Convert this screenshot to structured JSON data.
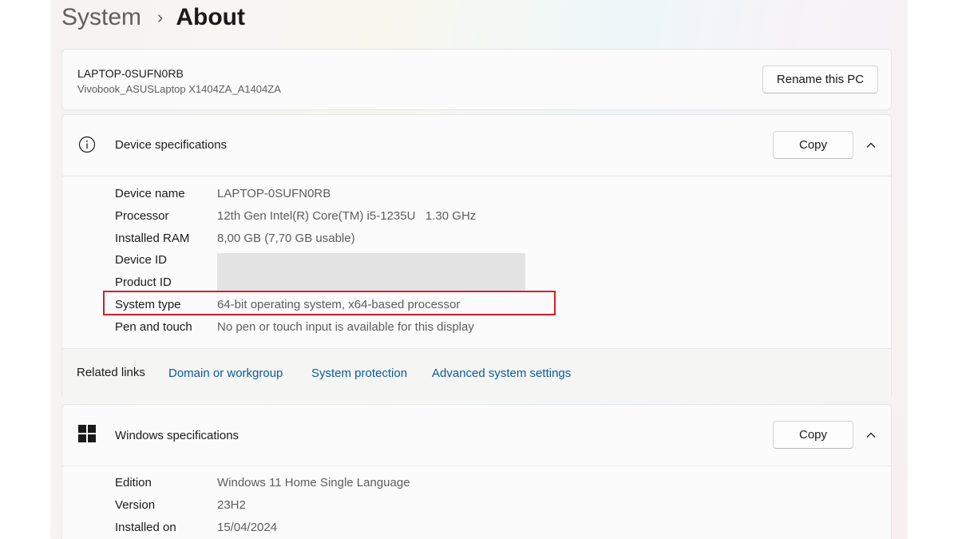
{
  "breadcrumb": {
    "parent": "System",
    "separator": "›",
    "current": "About"
  },
  "pc": {
    "name": "LAPTOP-0SUFN0RB",
    "model": "Vivobook_ASUSLaptop X1404ZA_A1404ZA",
    "rename_label": "Rename this PC"
  },
  "device_specs": {
    "title": "Device specifications",
    "copy_label": "Copy",
    "rows": [
      {
        "label": "Device name",
        "value": "LAPTOP-0SUFN0RB"
      },
      {
        "label": "Processor",
        "value": "12th Gen Intel(R) Core(TM) i5-1235U   1.30 GHz"
      },
      {
        "label": "Installed RAM",
        "value": "8,00 GB (7,70 GB usable)"
      },
      {
        "label": "Device ID",
        "value": ""
      },
      {
        "label": "Product ID",
        "value": ""
      },
      {
        "label": "System type",
        "value": "64-bit operating system, x64-based processor"
      },
      {
        "label": "Pen and touch",
        "value": "No pen or touch input is available for this display"
      }
    ],
    "related_label": "Related links",
    "related_links": [
      "Domain or workgroup",
      "System protection",
      "Advanced system settings"
    ]
  },
  "windows_specs": {
    "title": "Windows specifications",
    "copy_label": "Copy",
    "rows": [
      {
        "label": "Edition",
        "value": "Windows 11 Home Single Language"
      },
      {
        "label": "Version",
        "value": "23H2"
      },
      {
        "label": "Installed on",
        "value": "15/04/2024"
      }
    ]
  },
  "icons": {
    "device_specs": "info-icon",
    "windows_specs": "windows-logo-icon",
    "collapse": "chevron-up-icon"
  },
  "colors": {
    "link": "#0b5a9a",
    "highlight_border": "#d2202a",
    "redaction": "#e3e3e3"
  }
}
